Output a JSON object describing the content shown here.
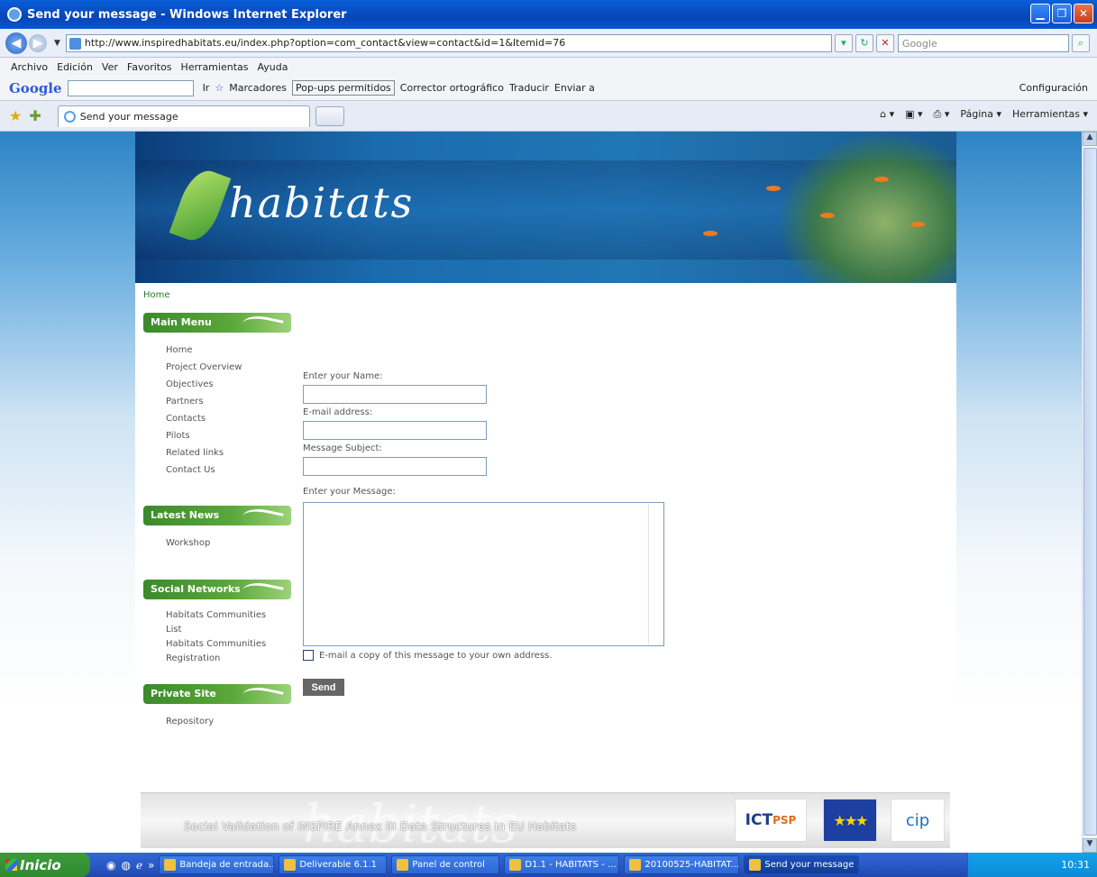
{
  "window": {
    "title": "Send your message - Windows Internet Explorer"
  },
  "address": {
    "url": "http://www.inspiredhabitats.eu/index.php?option=com_contact&view=contact&id=1&Itemid=76",
    "search_placeholder": "Google"
  },
  "menubar": [
    "Archivo",
    "Edición",
    "Ver",
    "Favoritos",
    "Herramientas",
    "Ayuda"
  ],
  "google_toolbar": {
    "logo": "Google",
    "go": "Ir",
    "bookmarks": "Marcadores",
    "popups": "Pop-ups permitidos",
    "spell": "Corrector ortográfico",
    "translate": "Traducir",
    "send": "Enviar a",
    "settings": "Configuración"
  },
  "tab": {
    "label": "Send your message"
  },
  "command_bar": {
    "page": "Página",
    "tools": "Herramientas"
  },
  "site": {
    "logo": "habitats",
    "breadcrumb": "Home"
  },
  "sidebar": {
    "main_menu": {
      "title": "Main Menu",
      "items": [
        "Home",
        "Project Overview",
        "Objectives",
        "Partners",
        "Contacts",
        "Pilots",
        "Related links",
        "Contact Us"
      ]
    },
    "latest_news": {
      "title": "Latest News",
      "items": [
        "Workshop"
      ]
    },
    "social": {
      "title": "Social Networks",
      "items": [
        "Habitats Communities List",
        "Habitats Communities Registration"
      ]
    },
    "private": {
      "title": "Private Site",
      "items": [
        "Repository"
      ]
    }
  },
  "form": {
    "name_label": "Enter your Name:",
    "email_label": "E-mail address:",
    "subject_label": "Message Subject:",
    "message_label": "Enter your Message:",
    "copy_label": "E-mail a copy of this message to your own address.",
    "send": "Send"
  },
  "footer": {
    "slogan": "Social Validation of INSPIRE Annex III Data Structures in EU Habitats",
    "ict": "ICT",
    "ict_sub": "PSP",
    "cip": "cip"
  },
  "taskbar": {
    "start": "Inicio",
    "tasks": [
      "Bandeja de entrada...",
      "Deliverable 6.1.1",
      "Panel de control",
      "D1.1 - HABITATS - ...",
      "20100525-HABITAT...",
      "Send your message ..."
    ],
    "clock": "10:31"
  }
}
